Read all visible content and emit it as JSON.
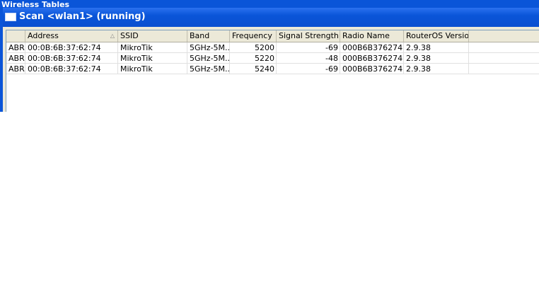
{
  "background_window": {
    "title": "Wireless Tables"
  },
  "scan_window": {
    "title": "Scan <wlan1> (running)"
  },
  "table": {
    "columns": [
      "",
      "Address",
      "SSID",
      "Band",
      "Frequency",
      "Signal Strength",
      "Radio Name",
      "RouterOS Version"
    ],
    "sorted_column": "Address",
    "rows": [
      {
        "flags": "ABR",
        "address": "00:0B:6B:37:62:74",
        "ssid": "MikroTik",
        "band": "5GHz-5M...",
        "frequency": "5200",
        "signal": "-69",
        "radio_name": "000B6B376274",
        "version": "2.9.38"
      },
      {
        "flags": "ABR",
        "address": "00:0B:6B:37:62:74",
        "ssid": "MikroTik",
        "band": "5GHz-5M...",
        "frequency": "5220",
        "signal": "-48",
        "radio_name": "000B6B376274",
        "version": "2.9.38"
      },
      {
        "flags": "ABR",
        "address": "00:0B:6B:37:62:74",
        "ssid": "MikroTik",
        "band": "5GHz-5M...",
        "frequency": "5240",
        "signal": "-69",
        "radio_name": "000B6B376274",
        "version": "2.9.38"
      }
    ]
  },
  "colors": {
    "title_bar": "#0a55d8",
    "window_face": "#ece9d8",
    "grid_background": "#ffffff"
  },
  "icons": {
    "window_icon": "window-icon",
    "sort_indicator": "sort-ascending-icon"
  }
}
